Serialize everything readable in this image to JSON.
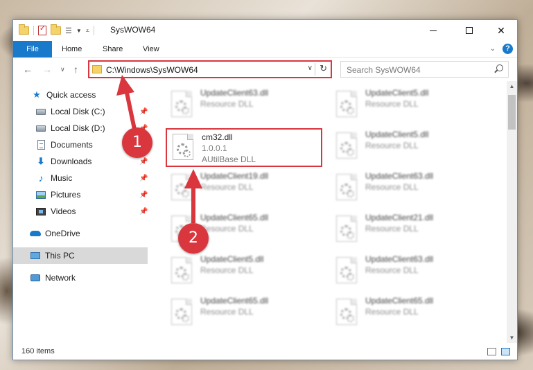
{
  "window": {
    "title": "SysWOW64",
    "controls": {
      "minimize": "",
      "maximize": "",
      "close": "✕"
    }
  },
  "ribbon": {
    "tabs": [
      {
        "label": "File"
      },
      {
        "label": "Home"
      },
      {
        "label": "Share"
      },
      {
        "label": "View"
      }
    ],
    "help": "?"
  },
  "address": {
    "path": "C:\\Windows\\SysWOW64",
    "search_placeholder": "Search SysWOW64"
  },
  "nav": {
    "items": [
      {
        "label": "Quick access"
      },
      {
        "label": "Local Disk (C:)"
      },
      {
        "label": "Local Disk (D:)"
      },
      {
        "label": "Documents"
      },
      {
        "label": "Downloads"
      },
      {
        "label": "Music"
      },
      {
        "label": "Pictures"
      },
      {
        "label": "Videos"
      },
      {
        "label": "OneDrive"
      },
      {
        "label": "This PC"
      },
      {
        "label": "Network"
      }
    ]
  },
  "files": {
    "highlighted": {
      "name": "cm32.dll",
      "version": "1.0.0.1",
      "description": "AUtilBase DLL"
    },
    "left_column": [
      {
        "name": "UpdateClient63.dll",
        "type": "Resource DLL"
      },
      {
        "name": "UpdateClient19.dll",
        "type": "Resource DLL"
      },
      {
        "name": "UpdateClient65.dll",
        "type": "Resource DLL"
      },
      {
        "name": "UpdateClient5.dll",
        "type": "Resource DLL"
      },
      {
        "name": "UpdateClient65.dll",
        "type": "Resource DLL"
      }
    ],
    "right_column": [
      {
        "name": "UpdateClient5.dll",
        "type": "Resource DLL"
      },
      {
        "name": "UpdateClient5.dll",
        "type": "Resource DLL"
      },
      {
        "name": "UpdateClient63.dll",
        "type": "Resource DLL"
      },
      {
        "name": "UpdateClient21.dll",
        "type": "Resource DLL"
      },
      {
        "name": "UpdateClient63.dll",
        "type": "Resource DLL"
      },
      {
        "name": "UpdateClient65.dll",
        "type": "Resource DLL"
      }
    ]
  },
  "status": {
    "item_count": "160 items"
  },
  "callouts": {
    "first": "1",
    "second": "2"
  },
  "colors": {
    "accent": "#1979ca",
    "highlight": "#d9363e"
  }
}
